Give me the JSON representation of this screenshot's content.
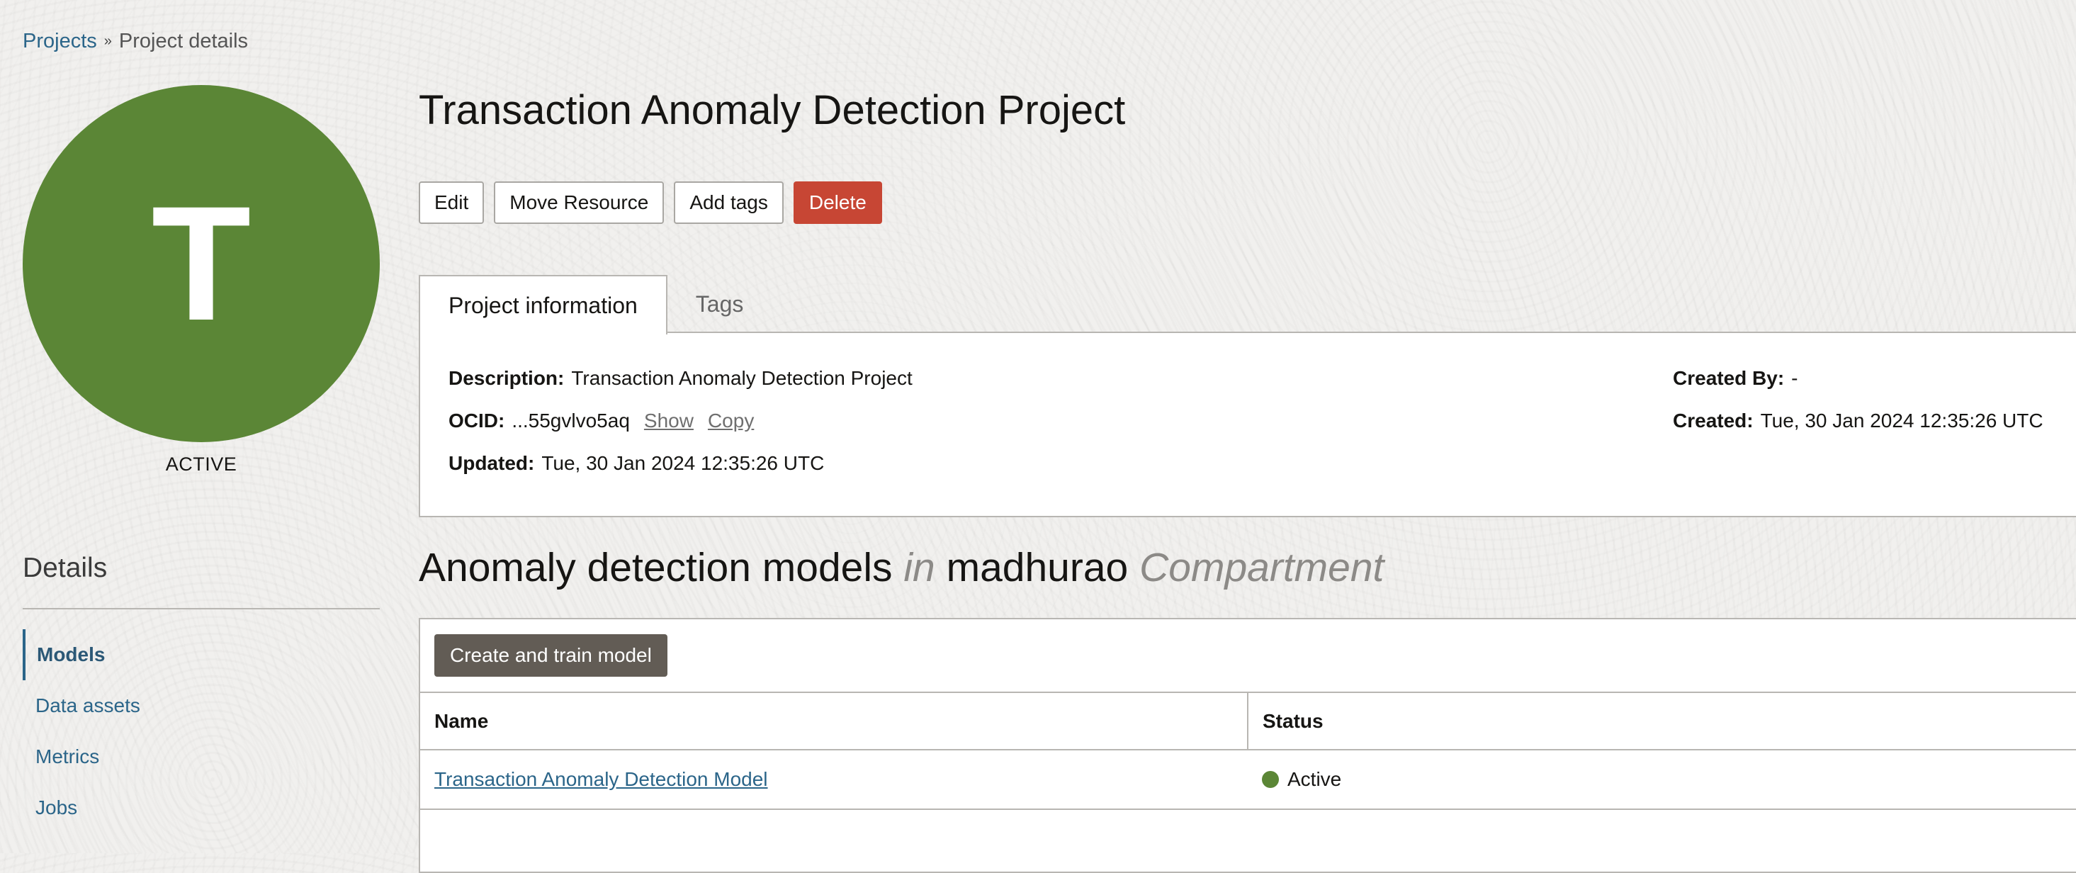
{
  "breadcrumb": {
    "root": "Projects",
    "separator": "»",
    "current": "Project details"
  },
  "avatar": {
    "letter": "T",
    "state": "ACTIVE",
    "color": "#5b8636"
  },
  "details": {
    "title": "Details",
    "nav": [
      {
        "label": "Models",
        "active": true
      },
      {
        "label": "Data assets",
        "active": false
      },
      {
        "label": "Metrics",
        "active": false
      },
      {
        "label": "Jobs",
        "active": false
      }
    ]
  },
  "project": {
    "title": "Transaction Anomaly Detection Project",
    "actions": {
      "edit": "Edit",
      "move": "Move Resource",
      "add_tags": "Add tags",
      "delete": "Delete"
    },
    "tabs": {
      "info": "Project information",
      "tags": "Tags"
    },
    "info": {
      "description_label": "Description:",
      "description_value": "Transaction Anomaly Detection Project",
      "ocid_label": "OCID:",
      "ocid_value": "...55gvlvo5aq",
      "ocid_show": "Show",
      "ocid_copy": "Copy",
      "updated_label": "Updated:",
      "updated_value": "Tue, 30 Jan 2024 12:35:26 UTC",
      "created_by_label": "Created By:",
      "created_by_value": "-",
      "created_label": "Created:",
      "created_value": "Tue, 30 Jan 2024 12:35:26 UTC"
    }
  },
  "models": {
    "heading": {
      "main": "Anomaly detection models",
      "in": "in",
      "compartment_name": "madhurao",
      "compartment_word": "Compartment"
    },
    "create_button": "Create and train model",
    "columns": {
      "name": "Name",
      "status": "Status"
    },
    "rows": [
      {
        "name": "Transaction Anomaly Detection Model",
        "status": "Active",
        "status_color": "#5b8636"
      }
    ]
  },
  "colors": {
    "link": "#2b6589",
    "danger": "#c74634",
    "primary_button": "#625c55",
    "active_green": "#5b8636"
  }
}
